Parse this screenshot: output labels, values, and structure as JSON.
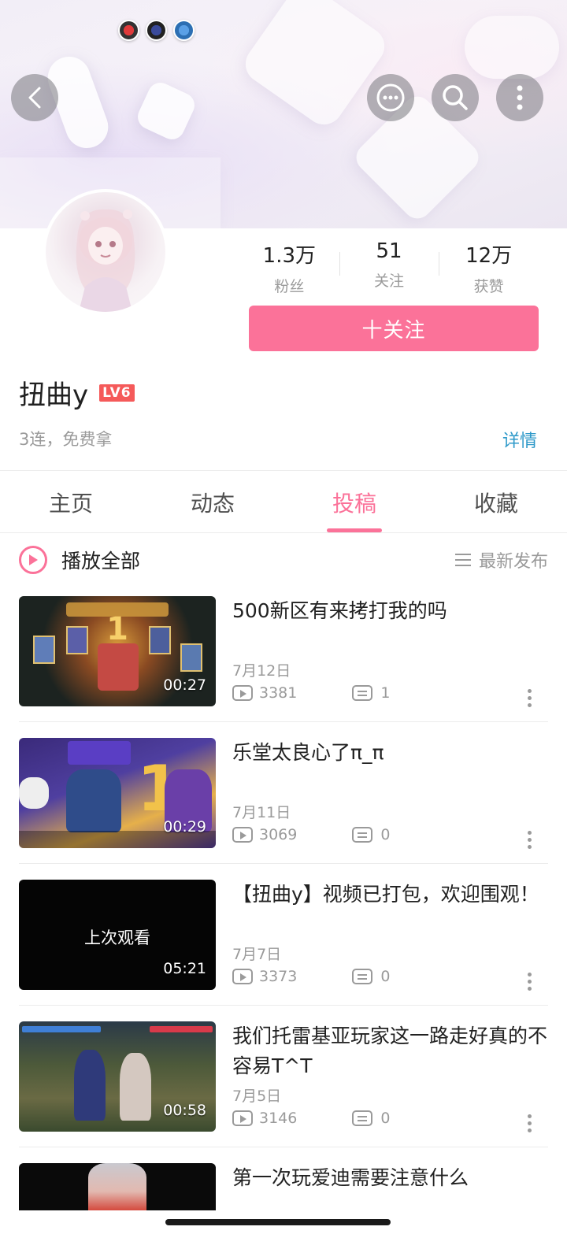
{
  "header": {
    "back_icon": "back-arrow-icon",
    "message_icon": "chat-bubble-icon",
    "search_icon": "search-icon",
    "more_icon": "more-vertical-icon"
  },
  "profile": {
    "stats": [
      {
        "value": "1.3万",
        "label": "粉丝"
      },
      {
        "value": "51",
        "label": "关注"
      },
      {
        "value": "12万",
        "label": "获赞"
      }
    ],
    "follow_label": "十关注",
    "username": "扭曲y",
    "level": "LV6",
    "bio": "3连，免费拿",
    "detail_label": "详情"
  },
  "tabs": [
    {
      "label": "主页",
      "active": false
    },
    {
      "label": "动态",
      "active": false
    },
    {
      "label": "投稿",
      "active": true
    },
    {
      "label": "收藏",
      "active": false
    }
  ],
  "playall": {
    "label": "播放全部",
    "sort_label": "最新发布"
  },
  "videos": [
    {
      "title": "500新区有来拷打我的吗",
      "date": "7月12日",
      "plays": "3381",
      "comments": "1",
      "duration": "00:27"
    },
    {
      "title": "乐堂太良心了π_π",
      "date": "7月11日",
      "plays": "3069",
      "comments": "0",
      "duration": "00:29"
    },
    {
      "title": "【扭曲y】视频已打包，欢迎围观！",
      "date": "7月7日",
      "plays": "3373",
      "comments": "0",
      "duration": "05:21",
      "overlay": "上次观看"
    },
    {
      "title": "我们托雷基亚玩家这一路走好真的不容易T^T",
      "date": "7月5日",
      "plays": "3146",
      "comments": "0",
      "duration": "00:58"
    },
    {
      "title": "第一次玩爱迪需要注意什么"
    }
  ],
  "colors": {
    "accent": "#fb7299",
    "link": "#2e99c9",
    "level_badge": "#f55a5a"
  }
}
